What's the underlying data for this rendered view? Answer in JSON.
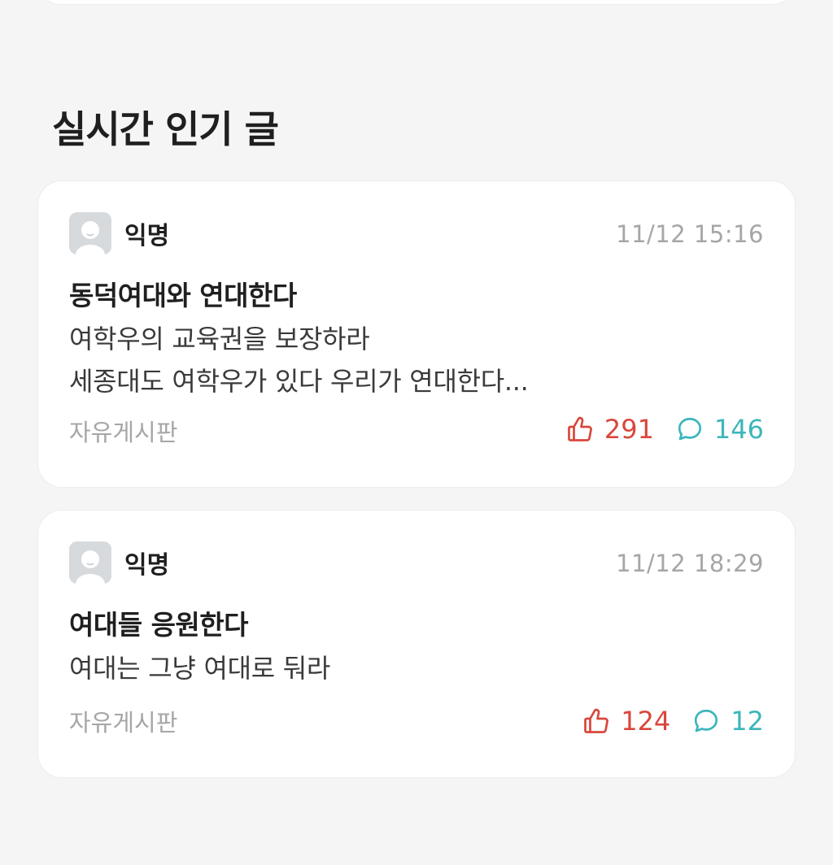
{
  "section": {
    "title": "실시간 인기 글"
  },
  "posts": [
    {
      "author": "익명",
      "timestamp": "11/12 15:16",
      "title": "동덕여대와 연대한다",
      "body_lines": [
        "여학우의 교육권을 보장하라",
        "세종대도 여학우가 있다 우리가 연대한다..."
      ],
      "board": "자유게시판",
      "likes": "291",
      "comments": "146"
    },
    {
      "author": "익명",
      "timestamp": "11/12 18:29",
      "title": "여대들 응원한다",
      "body_lines": [
        "여대는 그냥 여대로 둬라"
      ],
      "board": "자유게시판",
      "likes": "124",
      "comments": "12"
    }
  ],
  "colors": {
    "like": "#d9473c",
    "comment": "#3cb6bb",
    "meta": "#a6a6a6",
    "background": "#f5f5f5"
  },
  "icons": {
    "avatar": "default-avatar-icon",
    "like": "thumbs-up-icon",
    "comment": "speech-bubble-icon"
  }
}
